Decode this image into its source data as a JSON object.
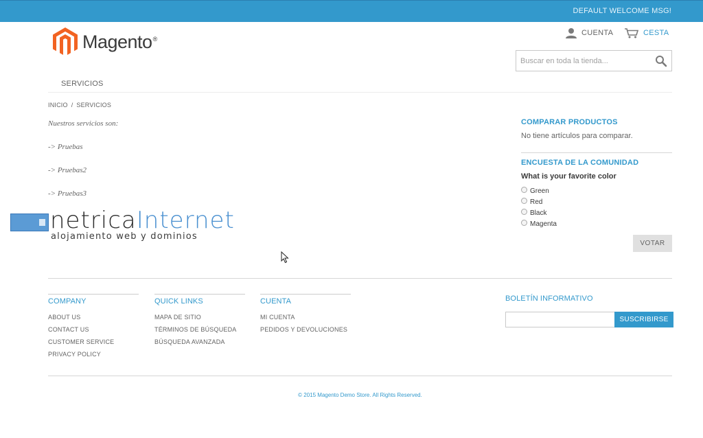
{
  "header": {
    "welcome": "DEFAULT WELCOME MSG!",
    "logo": {
      "text": "Magento",
      "mark": "®",
      "color": "#f26322"
    },
    "account_label": "CUENTA",
    "cart_label": "CESTA",
    "search": {
      "placeholder": "Buscar en toda la tienda...",
      "value": ""
    }
  },
  "nav": {
    "items": [
      {
        "label": "SERVICIOS"
      }
    ]
  },
  "breadcrumb": {
    "home": "INICIO",
    "separator": "/",
    "current": "SERVICIOS"
  },
  "content": {
    "intro": "Nuestros servicios son:",
    "items": [
      "-> Pruebas",
      "-> Pruebas2",
      "-> Pruebas3"
    ]
  },
  "banner": {
    "name_part1": "netrica",
    "name_part2": "Internet",
    "tagline": "alojamiento web y dominios"
  },
  "sidebar": {
    "compare": {
      "title": "COMPARAR PRODUCTOS",
      "empty_text": "No tiene artículos para comparar."
    },
    "poll": {
      "title": "ENCUESTA DE LA COMUNIDAD",
      "question": "What is your favorite color",
      "options": [
        "Green",
        "Red",
        "Black",
        "Magenta"
      ],
      "vote_label": "VOTAR"
    }
  },
  "footer": {
    "columns": [
      {
        "title": "COMPANY",
        "links": [
          "ABOUT US",
          "CONTACT US",
          "CUSTOMER SERVICE",
          "PRIVACY POLICY"
        ]
      },
      {
        "title": "QUICK LINKS",
        "links": [
          "MAPA DE SITIO",
          "TÉRMINOS DE BÚSQUEDA",
          "BÚSQUEDA AVANZADA"
        ]
      },
      {
        "title": "CUENTA",
        "links": [
          "MI CUENTA",
          "PEDIDOS Y DEVOLUCIONES"
        ]
      }
    ],
    "newsletter": {
      "title": "BOLETÍN INFORMATIVO",
      "button_label": "SUSCRIBIRSE",
      "value": ""
    },
    "copyright": "© 2015 Magento Demo Store. All Rights Reserved."
  },
  "colors": {
    "accent": "#3399cc",
    "text": "#636363",
    "logo_orange": "#f26322"
  }
}
